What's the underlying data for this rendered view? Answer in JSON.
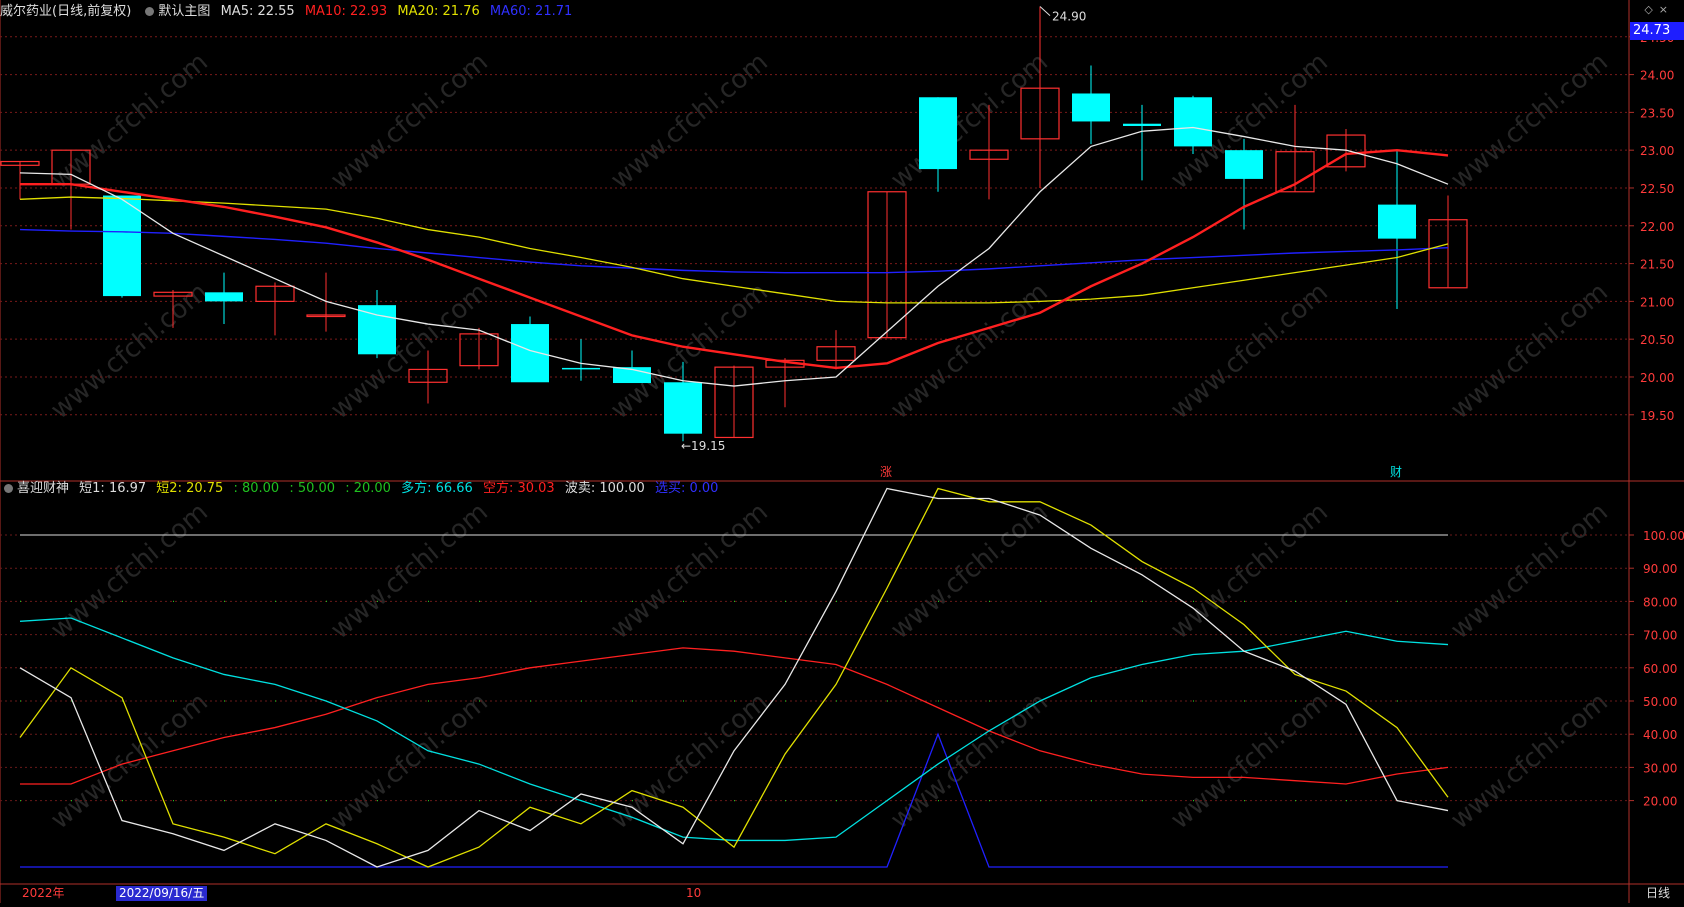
{
  "main_header": {
    "stock": "威尔药业(日线,前复权)",
    "template": "默认主图",
    "ma5": "MA5: 22.55",
    "ma10": "MA10: 22.93",
    "ma20": "MA20: 21.76",
    "ma60": "MA60: 21.71"
  },
  "indicator_header": {
    "name": "喜迎财神",
    "short1": "短1: 16.97",
    "short2": "短2: 20.75",
    "lv80": ": 80.00",
    "lv50": ": 50.00",
    "lv20": ": 20.00",
    "bull": "多方: 66.66",
    "bear": "空方: 30.03",
    "swing": "波卖: 100.00",
    "trend": "选买: 0.00"
  },
  "last_price": "24.73",
  "date_axis": {
    "year": "2022年",
    "cursor": "2022/09/16/五",
    "month": "10",
    "period": "日线"
  },
  "annotations": {
    "high": "24.90",
    "low": "←19.15",
    "mark_zhang": "涨",
    "mark_cai": "财"
  },
  "watermark": "www.cfchi.com",
  "colors": {
    "up": "#ff3030",
    "down": "#00ffff",
    "ma5": "#e8e8e8",
    "ma10": "#ff2020",
    "ma20": "#e0e000",
    "ma60": "#2020ff",
    "axis": "#b0302a"
  },
  "chart_data": [
    {
      "type": "candlestick",
      "title": "威尔药业(日线,前复权)",
      "ylim": [
        19.0,
        25.0
      ],
      "y_ticks": [
        "24.50",
        "24.00",
        "23.50",
        "23.00",
        "22.50",
        "22.00",
        "21.50",
        "21.00",
        "20.50",
        "20.00",
        "19.50"
      ],
      "candles": [
        {
          "o": 22.8,
          "h": 22.85,
          "l": 22.35,
          "c": 22.85
        },
        {
          "o": 22.55,
          "h": 23.0,
          "l": 21.95,
          "c": 23.0
        },
        {
          "o": 22.4,
          "h": 22.4,
          "l": 21.05,
          "c": 21.07
        },
        {
          "o": 21.07,
          "h": 21.15,
          "l": 20.65,
          "c": 21.12
        },
        {
          "o": 21.12,
          "h": 21.38,
          "l": 20.7,
          "c": 21.0
        },
        {
          "o": 21.0,
          "h": 21.25,
          "l": 20.55,
          "c": 21.2
        },
        {
          "o": 20.8,
          "h": 21.38,
          "l": 20.6,
          "c": 20.82
        },
        {
          "o": 20.95,
          "h": 21.15,
          "l": 20.25,
          "c": 20.3
        },
        {
          "o": 19.93,
          "h": 20.35,
          "l": 19.65,
          "c": 20.1
        },
        {
          "o": 20.15,
          "h": 20.65,
          "l": 20.1,
          "c": 20.57
        },
        {
          "o": 20.7,
          "h": 20.8,
          "l": 19.95,
          "c": 19.93
        },
        {
          "o": 20.12,
          "h": 20.5,
          "l": 19.95,
          "c": 20.1
        },
        {
          "o": 20.13,
          "h": 20.35,
          "l": 19.93,
          "c": 19.92
        },
        {
          "o": 19.93,
          "h": 20.2,
          "l": 19.15,
          "c": 19.25
        },
        {
          "o": 19.2,
          "h": 20.15,
          "l": 19.2,
          "c": 20.13
        },
        {
          "o": 20.13,
          "h": 20.25,
          "l": 19.6,
          "c": 20.22
        },
        {
          "o": 20.22,
          "h": 20.62,
          "l": 20.1,
          "c": 20.4
        },
        {
          "o": 20.52,
          "h": 22.45,
          "l": 20.52,
          "c": 22.45
        },
        {
          "o": 23.7,
          "h": 23.7,
          "l": 22.45,
          "c": 22.75
        },
        {
          "o": 22.88,
          "h": 23.6,
          "l": 22.35,
          "c": 23.0
        },
        {
          "o": 23.15,
          "h": 24.9,
          "l": 22.5,
          "c": 23.82
        },
        {
          "o": 23.75,
          "h": 24.12,
          "l": 23.08,
          "c": 23.38
        },
        {
          "o": 23.35,
          "h": 23.6,
          "l": 22.6,
          "c": 23.32
        },
        {
          "o": 23.7,
          "h": 23.72,
          "l": 22.95,
          "c": 23.05
        },
        {
          "o": 23.0,
          "h": 23.15,
          "l": 21.95,
          "c": 22.62
        },
        {
          "o": 22.45,
          "h": 23.6,
          "l": 22.45,
          "c": 22.98
        },
        {
          "o": 22.78,
          "h": 23.28,
          "l": 22.72,
          "c": 23.2
        },
        {
          "o": 22.28,
          "h": 23.0,
          "l": 20.9,
          "c": 21.83
        },
        {
          "o": 21.18,
          "h": 22.4,
          "l": 21.18,
          "c": 22.08
        }
      ],
      "ma5": [
        22.7,
        22.68,
        22.35,
        21.9,
        21.6,
        21.3,
        21.0,
        20.82,
        20.7,
        20.62,
        20.35,
        20.18,
        20.1,
        19.95,
        19.88,
        19.95,
        20.0,
        20.6,
        21.2,
        21.7,
        22.45,
        23.05,
        23.25,
        23.3,
        23.18,
        23.05,
        23.0,
        22.82,
        22.55
      ],
      "ma10": [
        22.55,
        22.55,
        22.45,
        22.35,
        22.25,
        22.12,
        21.98,
        21.78,
        21.55,
        21.3,
        21.05,
        20.8,
        20.55,
        20.4,
        20.3,
        20.2,
        20.12,
        20.18,
        20.45,
        20.65,
        20.85,
        21.2,
        21.5,
        21.85,
        22.25,
        22.55,
        22.95,
        23.0,
        22.93
      ],
      "ma20": [
        22.35,
        22.38,
        22.36,
        22.33,
        22.3,
        22.26,
        22.22,
        22.1,
        21.95,
        21.85,
        21.7,
        21.58,
        21.45,
        21.3,
        21.2,
        21.1,
        21.0,
        20.98,
        20.98,
        20.98,
        21.0,
        21.03,
        21.08,
        21.18,
        21.28,
        21.38,
        21.48,
        21.58,
        21.76
      ],
      "ma60": [
        21.95,
        21.93,
        21.92,
        21.9,
        21.86,
        21.82,
        21.77,
        21.7,
        21.64,
        21.58,
        21.52,
        21.47,
        21.44,
        21.41,
        21.39,
        21.38,
        21.38,
        21.38,
        21.4,
        21.43,
        21.47,
        21.51,
        21.55,
        21.58,
        21.61,
        21.64,
        21.66,
        21.68,
        21.71
      ]
    },
    {
      "type": "line",
      "title": "喜迎财神",
      "ylim": [
        0,
        115
      ],
      "y_ticks": [
        "100.00",
        "90.00",
        "80.00",
        "70.00",
        "60.00",
        "50.00",
        "40.00",
        "30.00",
        "20.00"
      ],
      "ref_lines": [
        100,
        80,
        50,
        20
      ],
      "series": [
        {
          "name": "短1",
          "color": "#e8e8e8",
          "values": [
            60,
            51,
            14,
            10,
            5,
            13,
            8,
            0,
            5,
            17,
            11,
            22,
            18,
            7,
            35,
            55,
            83,
            114,
            111,
            111,
            106,
            96,
            88,
            78,
            65,
            59,
            49,
            20,
            17
          ]
        },
        {
          "name": "短2",
          "color": "#e0e000",
          "values": [
            39,
            60,
            51,
            13,
            9,
            4,
            13,
            7,
            0,
            6,
            18,
            13,
            23,
            18,
            6,
            34,
            55,
            84,
            114,
            110,
            110,
            103,
            92,
            84,
            73,
            58,
            53,
            42,
            21
          ]
        },
        {
          "name": "多方",
          "color": "#00e0e0",
          "values": [
            74,
            75,
            69,
            63,
            58,
            55,
            50,
            44,
            35,
            31,
            25,
            20,
            15,
            9,
            8,
            8,
            9,
            20,
            31,
            41,
            50,
            57,
            61,
            64,
            65,
            68,
            71,
            68,
            67
          ]
        },
        {
          "name": "空方",
          "color": "#ff2020",
          "values": [
            25,
            25,
            31,
            35,
            39,
            42,
            46,
            51,
            55,
            57,
            60,
            62,
            64,
            66,
            65,
            63,
            61,
            55,
            48,
            41,
            35,
            31,
            28,
            27,
            27,
            26,
            25,
            28,
            30
          ]
        },
        {
          "name": "选买",
          "color": "#2020ff",
          "values": [
            0,
            0,
            0,
            0,
            0,
            0,
            0,
            0,
            0,
            0,
            0,
            0,
            0,
            0,
            0,
            0,
            0,
            0,
            40,
            0,
            0,
            0,
            0,
            0,
            0,
            0,
            0,
            0,
            0
          ]
        }
      ]
    }
  ]
}
